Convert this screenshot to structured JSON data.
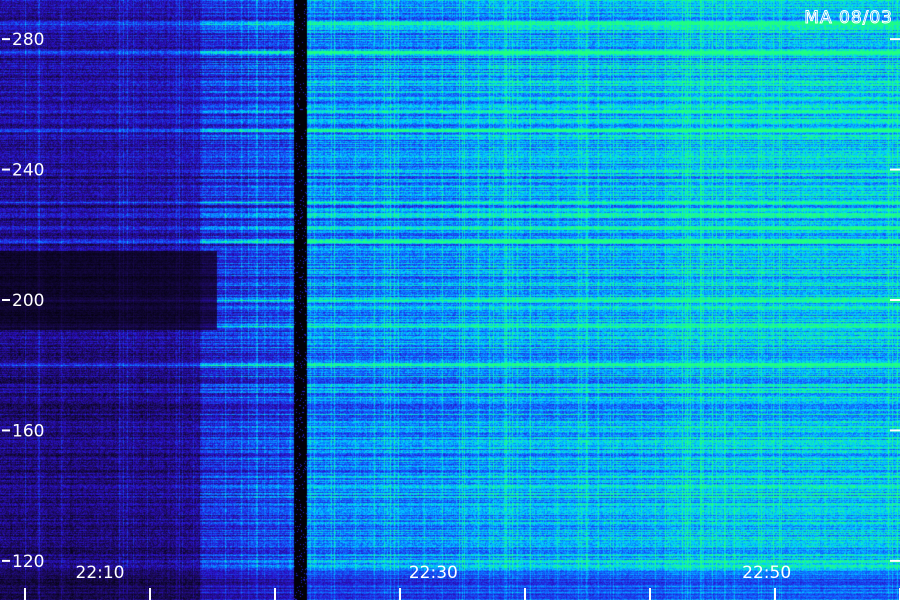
{
  "chart_data": {
    "type": "heatmap",
    "title": "",
    "corner_label": "MA 08/03",
    "xlabel": "",
    "ylabel": "",
    "x_range": [
      "22:04",
      "22:54"
    ],
    "ylim": [
      108,
      292
    ],
    "y_ticks": [
      120,
      160,
      200,
      240,
      280
    ],
    "x_tick_labels": [
      {
        "value": "22:10",
        "minutes": 6
      },
      {
        "value": "22:30",
        "minutes": 26
      },
      {
        "value": "22:50",
        "minutes": 46
      }
    ],
    "x_minor_ticks_minutes": [
      1.5,
      9,
      16.5,
      24,
      31.5,
      39,
      46.5,
      54
    ],
    "colormap": [
      "#000000",
      "#1a0a55",
      "#2a10c8",
      "#1060ff",
      "#00d0ff",
      "#20ff80"
    ],
    "gap_minutes": [
      17.6,
      18.4
    ],
    "sweep_start_minutes": 18.4,
    "grid": false,
    "legend": "none",
    "intensity_profile": {
      "time_segments_minutes": [
        0,
        12,
        18,
        28,
        40,
        54
      ],
      "mean_level": [
        0.18,
        0.28,
        0.48,
        0.55,
        0.62
      ],
      "bright_bands_y": [
        285,
        276,
        258,
        252,
        230,
        226,
        222,
        218,
        200,
        192,
        180
      ]
    }
  }
}
